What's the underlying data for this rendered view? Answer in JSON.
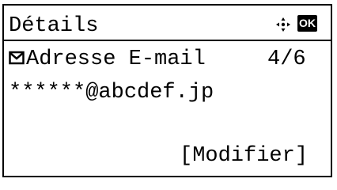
{
  "header": {
    "title": "Détails",
    "nav_icon": "four-way-navigation-icon",
    "ok_label": "OK"
  },
  "entry": {
    "type_icon": "envelope-icon",
    "label": "Adresse E-mail",
    "page_indicator": "4/6",
    "value": "******@abcdef.jp"
  },
  "softkey": {
    "label": "[Modifier]"
  }
}
